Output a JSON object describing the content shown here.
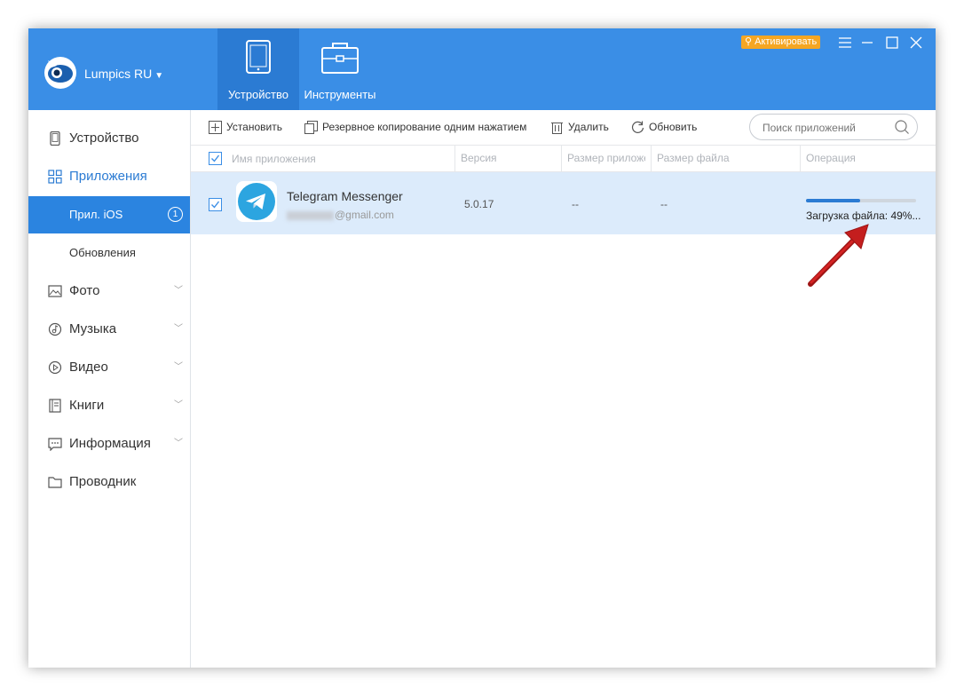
{
  "header": {
    "account": "Lumpics RU",
    "activate": "Активировать",
    "tabs": [
      {
        "label": "Устройство",
        "icon": "tablet-icon"
      },
      {
        "label": "Инструменты",
        "icon": "toolbox-icon"
      }
    ]
  },
  "sidebar": {
    "items": [
      {
        "label": "Устройство",
        "icon": "device-icon"
      },
      {
        "label": "Приложения",
        "icon": "apps-grid-icon"
      },
      {
        "label": "Фото",
        "icon": "photo-icon"
      },
      {
        "label": "Музыка",
        "icon": "music-icon"
      },
      {
        "label": "Видео",
        "icon": "video-icon"
      },
      {
        "label": "Книги",
        "icon": "books-icon"
      },
      {
        "label": "Информация",
        "icon": "info-chat-icon"
      },
      {
        "label": "Проводник",
        "icon": "folder-icon"
      }
    ],
    "subitems": [
      {
        "label": "Прил. iOS",
        "badge": "1"
      },
      {
        "label": "Обновления"
      }
    ]
  },
  "toolbar": {
    "install": "Установить",
    "backup": "Резервное копирование одним нажатием",
    "delete": "Удалить",
    "refresh": "Обновить",
    "search_placeholder": "Поиск приложений"
  },
  "table": {
    "headers": [
      "Имя приложения",
      "Версия",
      "Размер приложе",
      "Размер файла",
      "Операция"
    ],
    "rows": [
      {
        "name": "Telegram Messenger",
        "account_suffix": "@gmail.com",
        "version": "5.0.17",
        "app_size": "--",
        "file_size": "--",
        "progress": 0.49,
        "status": "Загрузка файла: 49%..."
      }
    ]
  },
  "colors": {
    "header_bg": "#3a8ee6",
    "accent": "#2b7bd3",
    "row_selected": "#dcebfb",
    "activate_bg": "#f5a623",
    "arrow": "#cc1f1f"
  }
}
